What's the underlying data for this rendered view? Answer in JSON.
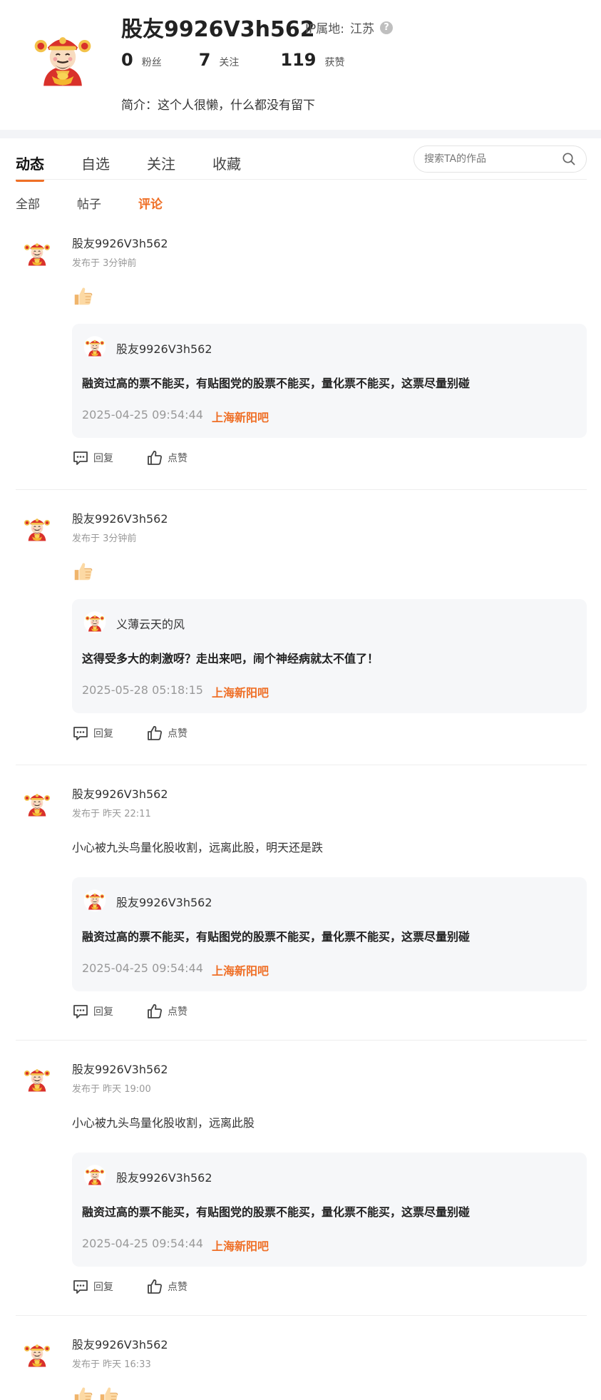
{
  "profile": {
    "avatar_icon": "god-of-wealth-avatar",
    "name": "股友9926V3h562",
    "ip_label": "IP属地:",
    "ip_value": "江苏",
    "help_glyph": "?",
    "stats": {
      "fans_count": "0",
      "fans_label": "粉丝",
      "following_count": "7",
      "following_label": "关注",
      "likes_count": "119",
      "likes_label": "获赞"
    },
    "bio": "简介：这个人很懒，什么都没有留下"
  },
  "tabs": {
    "main": [
      "动态",
      "自选",
      "关注",
      "收藏"
    ],
    "active_main": 0,
    "sub": [
      "全部",
      "帖子",
      "评论"
    ],
    "active_sub": 2,
    "search_placeholder": "搜索TA的作品"
  },
  "posts": [
    {
      "author": "股友9926V3h562",
      "time": "发布于 3分钟前",
      "content": "",
      "thumbs": 1,
      "quote": {
        "author": "股友9926V3h562",
        "text": "融资过高的票不能买，有贴图党的股票不能买，量化票不能买，这票尽量别碰",
        "date": "2025-04-25 09:54:44",
        "forum": "上海新阳吧"
      },
      "reply_label": "回复",
      "like_label": "点赞"
    },
    {
      "author": "股友9926V3h562",
      "time": "发布于 3分钟前",
      "content": "",
      "thumbs": 1,
      "quote": {
        "author": "义薄云天的风",
        "text": "这得受多大的刺激呀？走出来吧，闹个神经病就太不值了！",
        "date": "2025-05-28 05:18:15",
        "forum": "上海新阳吧"
      },
      "reply_label": "回复",
      "like_label": "点赞"
    },
    {
      "author": "股友9926V3h562",
      "time": "发布于 昨天 22:11",
      "content": "小心被九头鸟量化股收割，远离此股，明天还是跌",
      "thumbs": 0,
      "quote": {
        "author": "股友9926V3h562",
        "text": "融资过高的票不能买，有贴图党的股票不能买，量化票不能买，这票尽量别碰",
        "date": "2025-04-25 09:54:44",
        "forum": "上海新阳吧"
      },
      "reply_label": "回复",
      "like_label": "点赞"
    },
    {
      "author": "股友9926V3h562",
      "time": "发布于 昨天 19:00",
      "content": "小心被九头鸟量化股收割，远离此股",
      "thumbs": 0,
      "quote": {
        "author": "股友9926V3h562",
        "text": "融资过高的票不能买，有贴图党的股票不能买，量化票不能买，这票尽量别碰",
        "date": "2025-04-25 09:54:44",
        "forum": "上海新阳吧"
      },
      "reply_label": "回复",
      "like_label": "点赞"
    },
    {
      "author": "股友9926V3h562",
      "time": "发布于 昨天 16:33",
      "content": "",
      "thumbs": 2,
      "quote": null,
      "reply_label": "",
      "like_label": ""
    }
  ],
  "colors": {
    "accent": "#ef6f26",
    "quote_bg": "#f6f7f9",
    "band_bg": "#f3f4f7",
    "muted_text": "#999999"
  }
}
